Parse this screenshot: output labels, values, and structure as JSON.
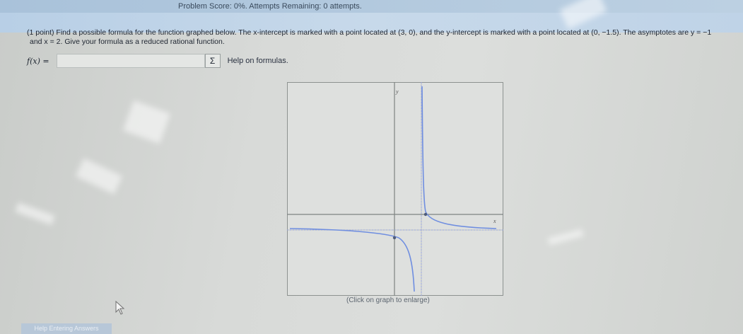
{
  "header": {
    "score_text": "Problem Score: 0%. Attempts Remaining: 0 attempts."
  },
  "problem": {
    "line1": "(1 point) Find a possible formula for the function graphed below. The x-intercept is marked with a point located at (3, 0), and the y-intercept is marked with a point located at (0, −1.5). The asymptotes are y = −1",
    "line2": "and x = 2. Give your formula as a reduced rational function."
  },
  "answer": {
    "label": "f(x) =",
    "value": "",
    "sigma": "Σ",
    "help_link": "Help on formulas."
  },
  "graph": {
    "y_axis_label": "y",
    "x_axis_label": "x",
    "caption": "(Click on graph to enlarge)"
  },
  "footer": {
    "help_entering": "Help Entering Answers"
  }
}
